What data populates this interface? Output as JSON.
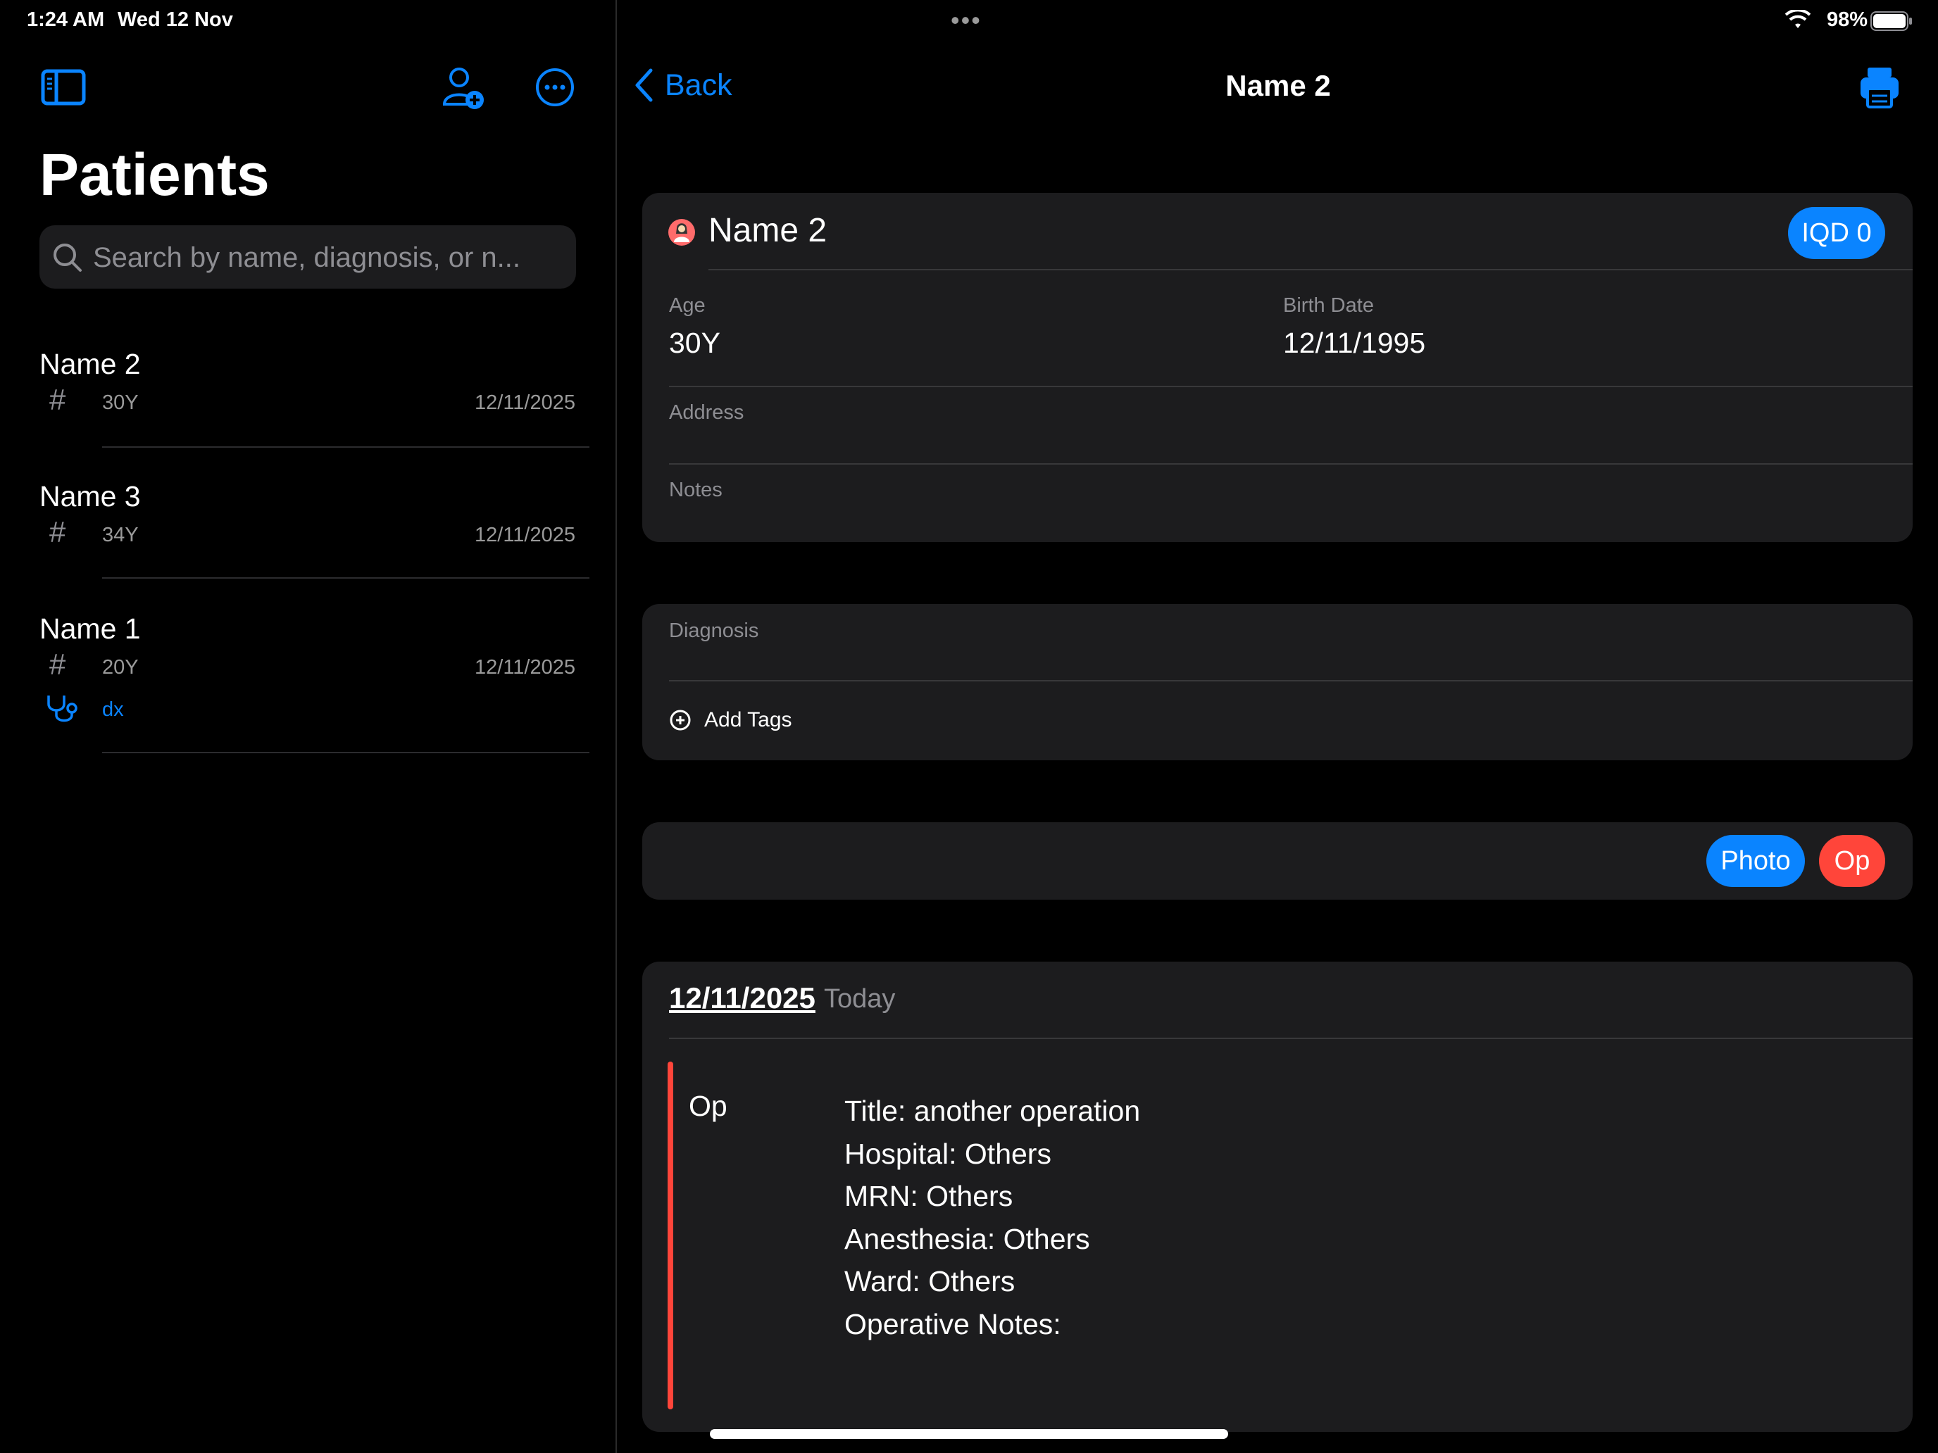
{
  "status": {
    "time": "1:24 AM",
    "date": "Wed 12 Nov",
    "battery": "98%"
  },
  "sidebar": {
    "title": "Patients",
    "search_placeholder": "Search by name, diagnosis, or n...",
    "patients": [
      {
        "name": "Name 2",
        "age": "30Y",
        "date": "12/11/2025"
      },
      {
        "name": "Name 3",
        "age": "34Y",
        "date": "12/11/2025"
      },
      {
        "name": "Name 1",
        "age": "20Y",
        "date": "12/11/2025",
        "dx": "dx"
      }
    ]
  },
  "detail": {
    "back_label": "Back",
    "nav_title": "Name 2",
    "patient_name": "Name 2",
    "balance": "IQD 0",
    "age_label": "Age",
    "age_value": "30Y",
    "birth_label": "Birth Date",
    "birth_value": "12/11/1995",
    "address_label": "Address",
    "notes_label": "Notes",
    "diagnosis_label": "Diagnosis",
    "add_tags_label": "Add Tags",
    "photo_button": "Photo",
    "op_button": "Op",
    "entry": {
      "date": "12/11/2025",
      "relative": "Today",
      "type": "Op",
      "lines": [
        "Title: another operation",
        "Hospital: Others",
        "MRN: Others",
        "Anesthesia: Others",
        "Ward: Others",
        "Operative Notes:"
      ]
    }
  },
  "colors": {
    "accent": "#0a84ff",
    "danger": "#ff453a",
    "card": "#1c1c1e"
  },
  "icons": [
    "sidebar-toggle-icon",
    "add-person-icon",
    "more-icon",
    "search-icon",
    "hash-icon",
    "stethoscope-icon",
    "chevron-left-icon",
    "printer-icon",
    "patient-female-icon",
    "plus-circle-icon",
    "wifi-icon",
    "battery-icon"
  ]
}
